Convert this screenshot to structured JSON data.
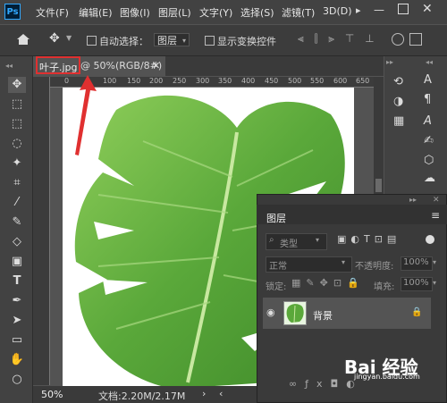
{
  "app": {
    "logo": "Ps"
  },
  "menu": [
    "文件(F)",
    "编辑(E)",
    "图像(I)",
    "图层(L)",
    "文字(Y)",
    "选择(S)",
    "滤镜(T)",
    "3D(D)"
  ],
  "options": {
    "auto_select_label": "自动选择：",
    "auto_select_value": "图层",
    "show_transform_label": "显示变换控件"
  },
  "document": {
    "tab_name": "叶子.jpg",
    "tab_info": "@ 50%(RGB/8#)",
    "zoom": "50%",
    "doc_info": "文档:2.20M/2.17M"
  },
  "ruler_ticks": [
    "0",
    "100",
    "150",
    "200",
    "250",
    "300",
    "350",
    "400",
    "450",
    "500",
    "550",
    "600",
    "650"
  ],
  "tools": [
    "move-icon",
    "artboard-icon",
    "marquee-icon",
    "lasso-icon",
    "magic-wand-icon",
    "crop-icon",
    "eyedropper-icon",
    "brush-icon",
    "stamp-icon",
    "eraser-icon",
    "gradient-icon",
    "text-icon",
    "pen-icon",
    "path-select-icon",
    "rectangle-icon",
    "hand-icon",
    "zoom-icon"
  ],
  "layers_panel": {
    "title": "图层",
    "kind_label": "类型",
    "blend_mode": "正常",
    "opacity_label": "不透明度:",
    "opacity_value": "100%",
    "lock_label": "锁定:",
    "fill_label": "填充:",
    "fill_value": "100%",
    "layer_name": "背景"
  },
  "watermark": {
    "main": "Bai 经验",
    "sub": "jingyan.baidu.com"
  },
  "colors": {
    "highlight": "#e03030",
    "leaf": "#5aa83a"
  }
}
